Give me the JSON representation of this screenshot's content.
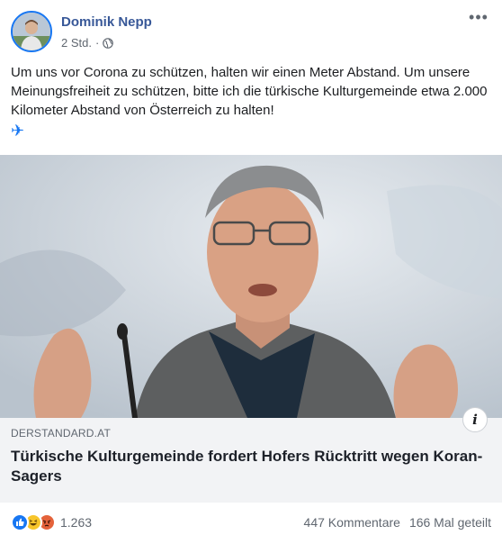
{
  "post": {
    "author": "Dominik Nepp",
    "time": "2 Std.",
    "separator": "·",
    "privacy_icon": "globe-icon",
    "more_icon": "more-options-icon",
    "text": "Um uns vor Corona zu schützen, halten wir einen Meter Abstand. Um unsere Meinungsfreiheit zu schützen, bitte ich die türkische Kulturgemeinde etwa 2.000 Kilometer Abstand von Österreich zu halten!",
    "emoji": "✈",
    "emoji_icon": "airplane-icon"
  },
  "link": {
    "domain": "DERSTANDARD.AT",
    "headline": "Türkische Kulturgemeinde fordert Hofers Rücktritt wegen Koran-Sagers",
    "info_label": "i"
  },
  "stats": {
    "reactions": [
      "like",
      "haha",
      "angry"
    ],
    "reaction_count": "1.263",
    "comments": "447 Kommentare",
    "shares": "166 Mal geteilt"
  },
  "colors": {
    "author_link": "#385898",
    "like_blue": "#1877f2",
    "haha_yellow": "#f7c52b",
    "angry_orange": "#e4623a",
    "card_bg": "#f2f3f5"
  }
}
